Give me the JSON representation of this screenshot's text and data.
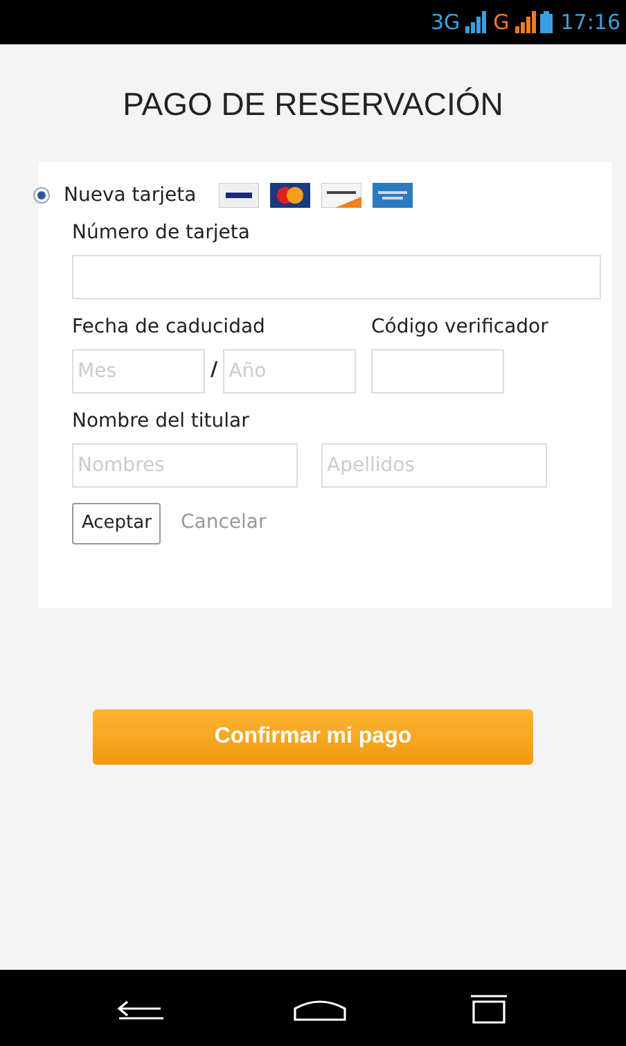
{
  "status_bar": {
    "network_1": "3G",
    "network_2": "G",
    "time": "17:16"
  },
  "title": "PAGO DE RESERVACIÓN",
  "payment_option": {
    "label": "Nueva tarjeta",
    "selected": true
  },
  "card_number": {
    "label": "Número de tarjeta"
  },
  "expiry": {
    "label": "Fecha de caducidad",
    "month_placeholder": "Mes",
    "separator": "/",
    "year_placeholder": "Año"
  },
  "cvv": {
    "label": "Código verificador"
  },
  "holder": {
    "label": "Nombre del titular",
    "first_placeholder": "Nombres",
    "last_placeholder": "Apellidos"
  },
  "accept_button": "Aceptar",
  "cancel_link": "Cancelar",
  "confirm_button": "Confirmar mi pago"
}
